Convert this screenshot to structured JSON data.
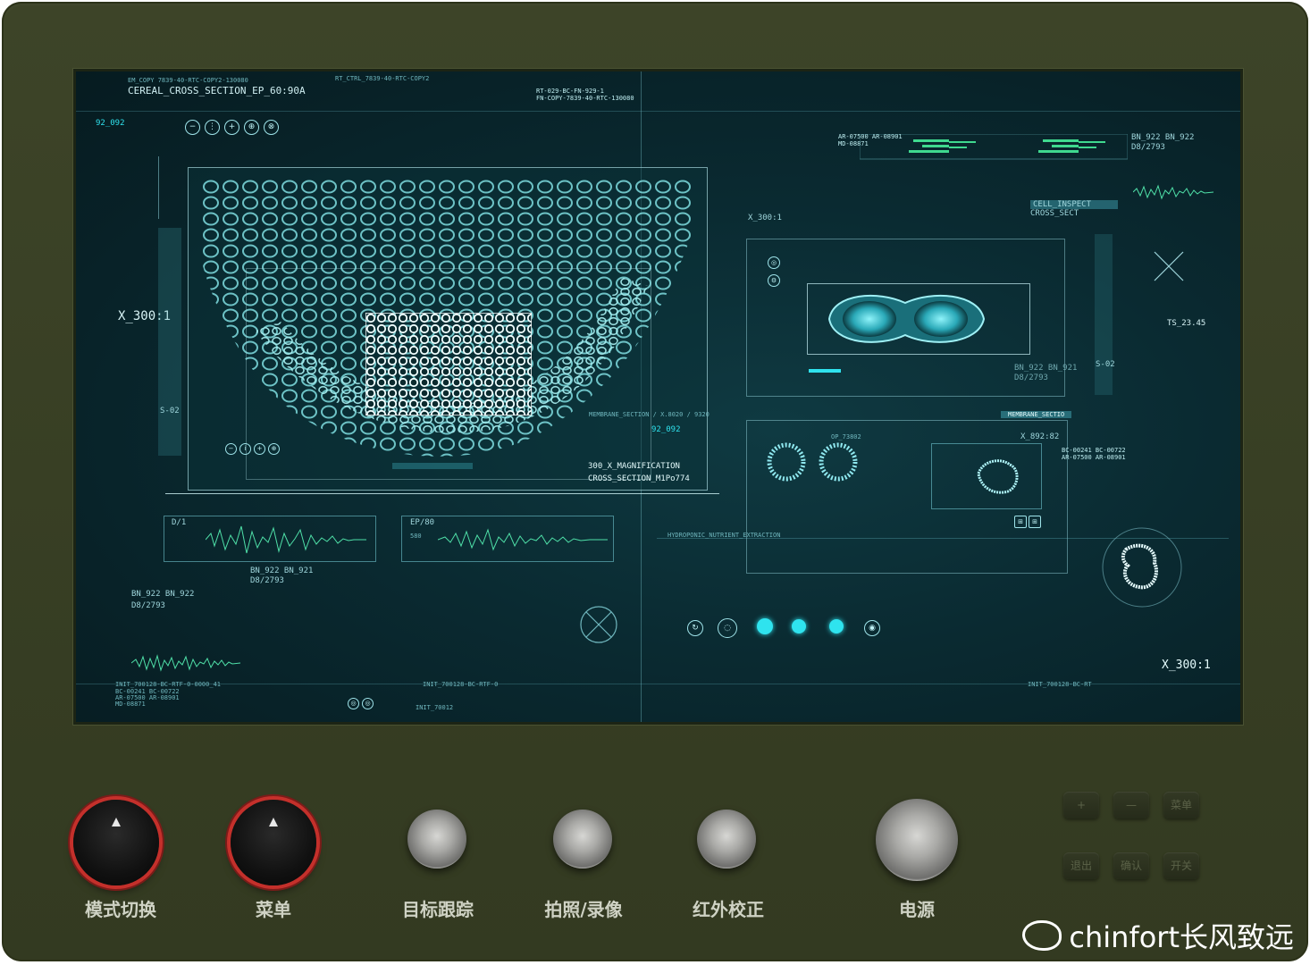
{
  "device": {
    "controls": {
      "mode_switch": "模式切换",
      "menu_knob": "菜单",
      "target_tracking": "目标跟踪",
      "photo_record": "拍照/录像",
      "ir_calibration": "红外校正",
      "power": "电源"
    },
    "keypad": {
      "plus": "+",
      "minus": "—",
      "menu": "菜单",
      "exit": "退出",
      "confirm": "确认",
      "toggle": "开关"
    },
    "watermark": "chinfort长风致远"
  },
  "screen": {
    "header_title": "CEREAL_CROSS_SECTION_EP_60:90A",
    "id_top_left": "92_092",
    "scale_left": "X_300:1",
    "side_label_left": "S-02",
    "micro_label": "92_092",
    "magnification_line1": "300_X_MAGNIFICATION",
    "magnification_line2": "CROSS_SECTION_M1Po774",
    "membrane_section": "MEMBRANE_SECTION / X.8020 / 9320",
    "wave1_title": "D/1",
    "wave2_title": "EP/80",
    "wave2_sub": "580",
    "bn_mid": "BN_922 BN_921",
    "db_mid": "D8/2793",
    "bn_left": "BN_922  BN_922",
    "db_left": "D8/2793",
    "init_left": "INIT_700128-BC-RTF-0-0000_41",
    "init_mid": "INIT_700128-BC-RTF-0",
    "init_bottom": "INIT_70012",
    "init_right": "INIT_700128-BC-RT",
    "codes_left": [
      "BC-00241   BC-00722",
      "AR-07500   AR-08901",
      "MD-08871"
    ],
    "scale_right_top": "X_300:1",
    "scale_right_bottom": "X_300:1",
    "cell_inspect_1": "CELL_INSPECT",
    "cell_inspect_2": "CROSS_SECT",
    "ts_label": "TS_23.45",
    "bn_right": "BN_922  BN_922",
    "db_right": "D8/2793",
    "bn_right2": "BN_922 BN_921",
    "db_right2": "D8/2793",
    "membrane_right": "MEMBRANE_SECTIO",
    "op_label": "OP_73802",
    "x_coord": "X_892:82",
    "hydroponic": "HYDROPONIC_NUTRIENT_EXTRACTION",
    "codes_right": [
      "BC-00241   BC-00722",
      "AR-07500   AR-08901"
    ],
    "ar_top": [
      "AR-07500  AR-08901",
      "MD-08871"
    ],
    "side_label_right": "S-02"
  }
}
